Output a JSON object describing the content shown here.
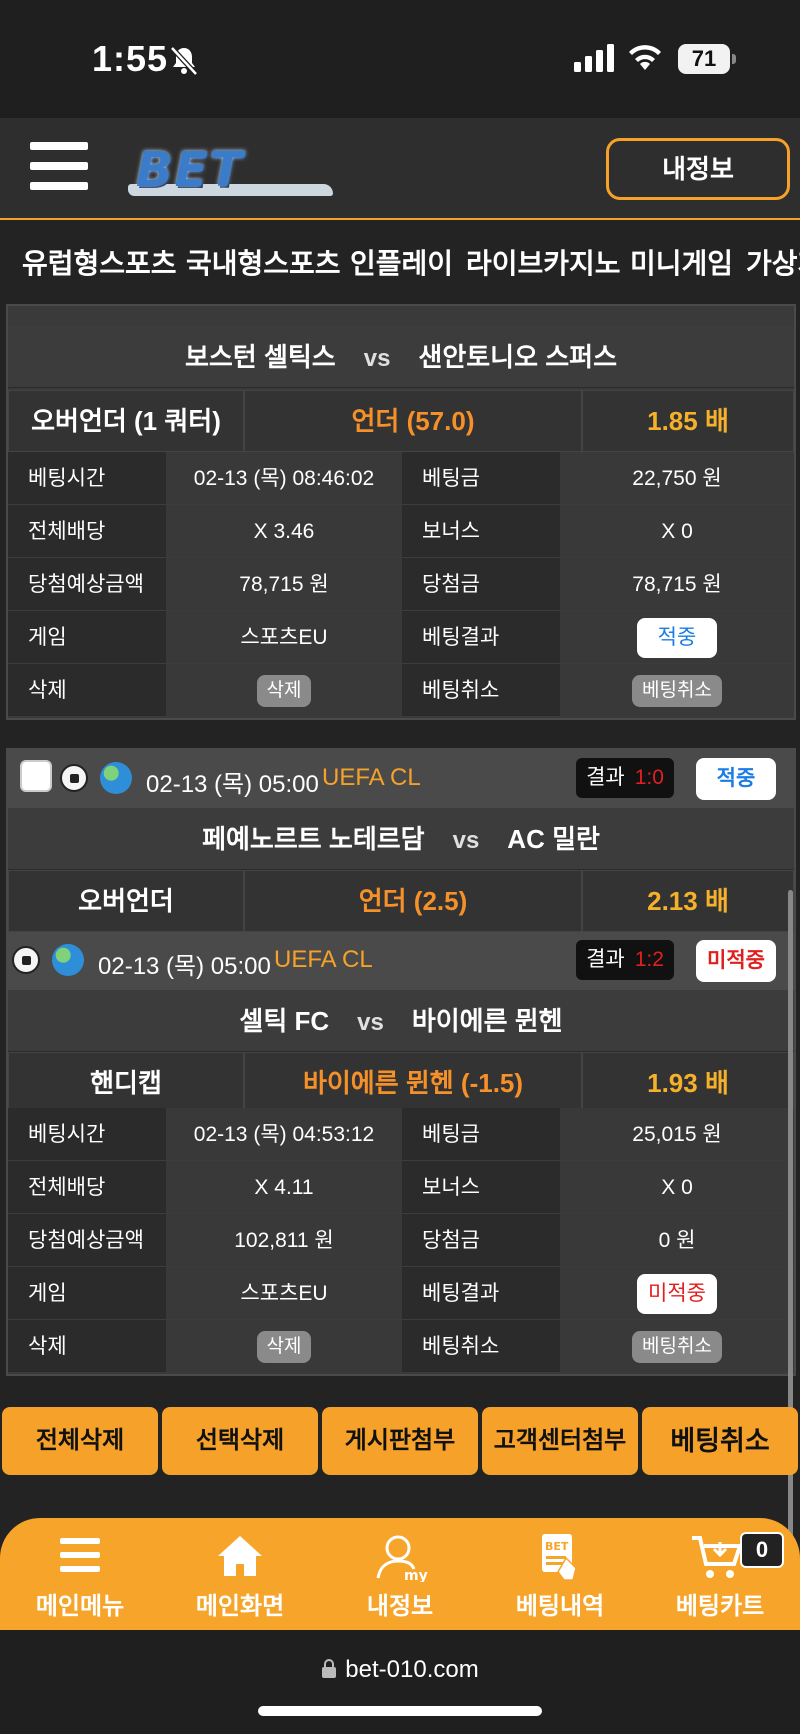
{
  "status_bar": {
    "time": "1:55",
    "battery": "71"
  },
  "header": {
    "logo": "BET",
    "myinfo_button": "내정보"
  },
  "nav": {
    "items": [
      "유럽형스포츠",
      "국내형스포츠",
      "인플레이",
      "라이브카지노",
      "미니게임",
      "가상게"
    ]
  },
  "bet1": {
    "match": {
      "home": "보스턴 셀틱스",
      "vs": "vs",
      "away": "샌안토니오 스퍼스"
    },
    "market": "오버언더 (1 쿼터)",
    "pick": "언더 (57.0)",
    "odds": "1.85 배",
    "details": {
      "bet_time_label": "베팅시간",
      "bet_time": "02-13 (목) 08:46:02",
      "stake_label": "베팅금",
      "stake": "22,750 원",
      "total_odds_label": "전체배당",
      "total_odds": "X 3.46",
      "bonus_label": "보너스",
      "bonus": "X 0",
      "expected_label": "당첨예상금액",
      "expected": "78,715 원",
      "win_label": "당첨금",
      "win": "78,715 원",
      "game_label": "게임",
      "game": "스포츠EU",
      "result_label": "베팅결과",
      "result": "적중",
      "delete_label": "삭제",
      "delete_btn": "삭제",
      "cancel_label": "베팅취소",
      "cancel_btn": "베팅취소"
    }
  },
  "bet2": {
    "game1": {
      "date": "02-13 (목) 05:00",
      "league": "UEFA CL",
      "result_label": "결과",
      "score": "1:0",
      "status": "적중",
      "home": "페예노르트 노테르담",
      "vs": "vs",
      "away": "AC 밀란",
      "market": "오버언더",
      "pick": "언더 (2.5)",
      "odds": "2.13 배"
    },
    "game2": {
      "date": "02-13 (목) 05:00",
      "league": "UEFA CL",
      "result_label": "결과",
      "score": "1:2",
      "status": "미적중",
      "home": "셀틱 FC",
      "vs": "vs",
      "away": "바이에른 뮌헨",
      "market": "핸디캡",
      "pick": "바이에른 뮌헨 (-1.5)",
      "odds": "1.93 배"
    },
    "details": {
      "bet_time_label": "베팅시간",
      "bet_time": "02-13 (목) 04:53:12",
      "stake_label": "베팅금",
      "stake": "25,015 원",
      "total_odds_label": "전체배당",
      "total_odds": "X 4.11",
      "bonus_label": "보너스",
      "bonus": "X 0",
      "expected_label": "당첨예상금액",
      "expected": "102,811 원",
      "win_label": "당첨금",
      "win": "0 원",
      "game_label": "게임",
      "game": "스포츠EU",
      "result_label": "베팅결과",
      "result": "미적중",
      "delete_label": "삭제",
      "delete_btn": "삭제",
      "cancel_label": "베팅취소",
      "cancel_btn": "베팅취소"
    }
  },
  "actions": [
    "전체삭제",
    "선택삭제",
    "게시판첨부",
    "고객센터첨부",
    "베팅취소"
  ],
  "bottom_nav": {
    "items": [
      "메인메뉴",
      "메인화면",
      "내정보",
      "베팅내역",
      "베팅카트"
    ],
    "cart_count": "0"
  },
  "url_bar": {
    "url": "bet-010.com"
  },
  "colors": {
    "accent": "#f6a12a",
    "background": "#232323",
    "win": "#1a7de6",
    "lose": "#e01f1f"
  }
}
